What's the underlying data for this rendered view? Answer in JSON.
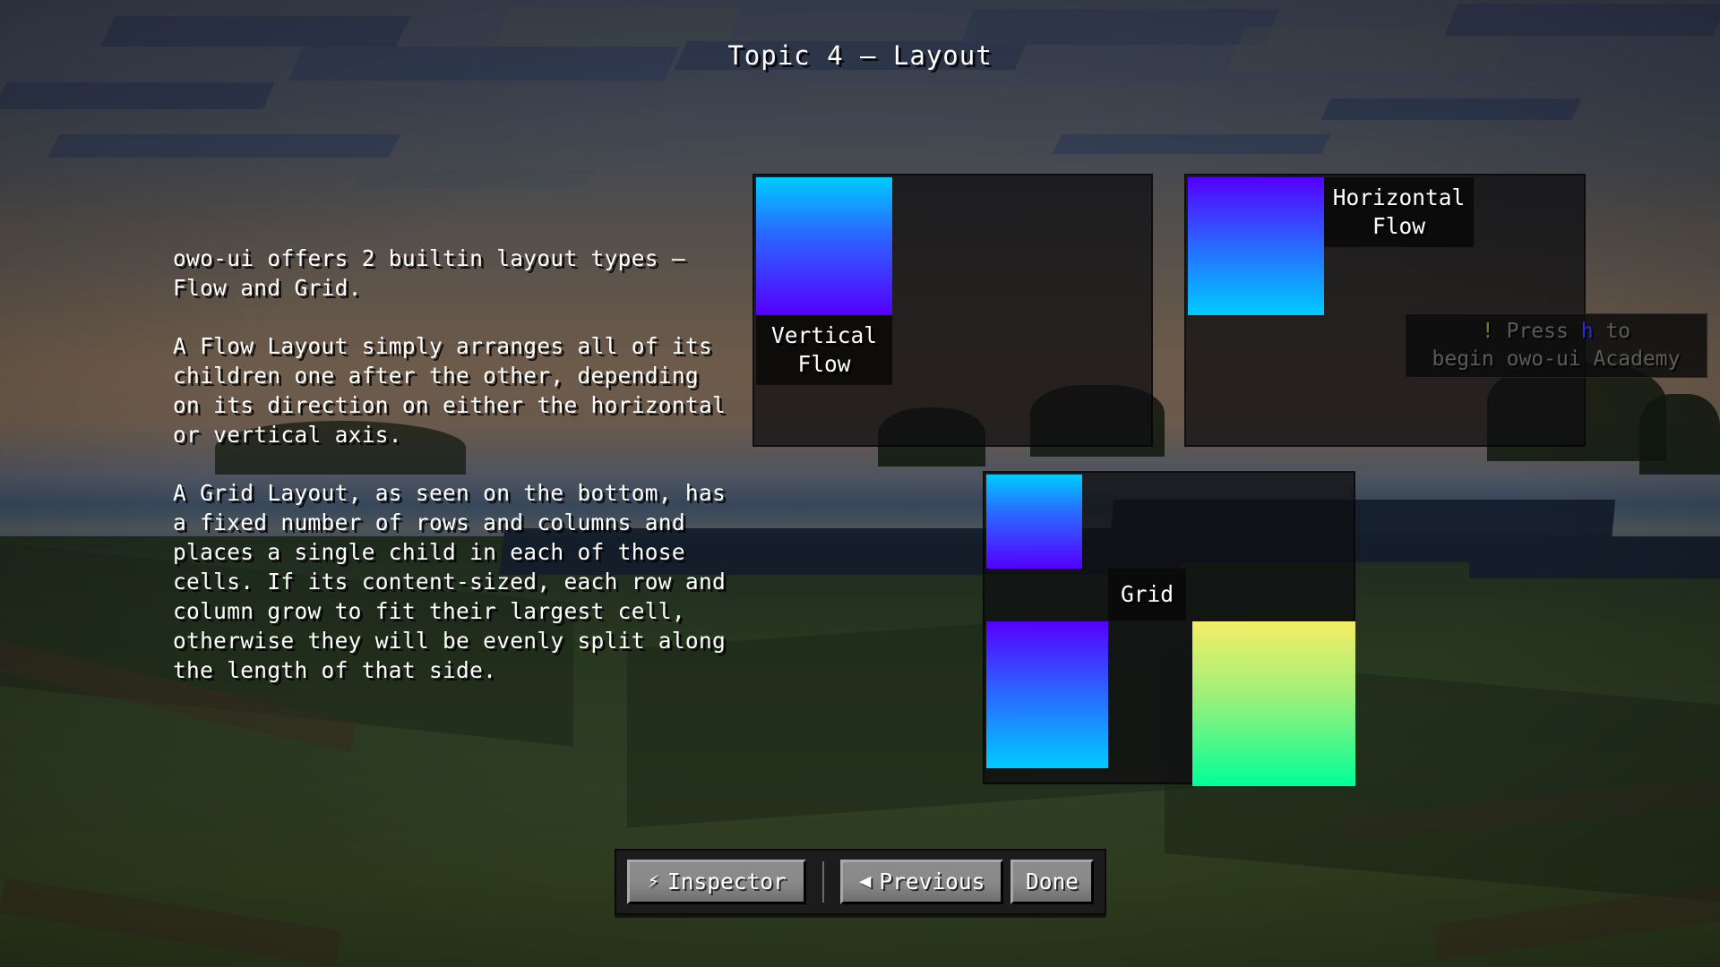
{
  "header": {
    "title": "Topic 4 – Layout"
  },
  "description": {
    "paragraphs": [
      "owo-ui offers 2 builtin layout types – Flow and Grid.",
      "A Flow Layout simply arranges all of its children one after the other, depending on its direction on either the horizontal or vertical axis.",
      "A Grid Layout, as seen on the bottom, has a fixed number of rows and columns and places a single child in each of those cells. If its content-sized, each row and column grow to fit their largest cell, otherwise they will be evenly split along the length of that side."
    ]
  },
  "demos": {
    "vertical_flow": {
      "label": "Vertical Flow",
      "swatch_gradient_from": "#00CCFF",
      "swatch_gradient_to": "#5500FF"
    },
    "horizontal_flow": {
      "label": "Horizontal Flow",
      "swatch_gradient_from": "#5500FF",
      "swatch_gradient_to": "#00CCFF"
    },
    "grid": {
      "label": "Grid",
      "cells": [
        {
          "position": "top-left",
          "gradient_from": "#00CCFF",
          "gradient_to": "#5500FF"
        },
        {
          "position": "bottom-left",
          "gradient_from": "#5500FF",
          "gradient_to": "#00CCFF"
        },
        {
          "position": "bottom-right",
          "gradient_from": "#F5EE66",
          "gradient_to": "#00FF99"
        }
      ]
    }
  },
  "toast": {
    "bang": "!",
    "before_key": "Press",
    "key": "h",
    "after_key": "to",
    "line2": "begin owo-ui Academy",
    "bang_color": "#7D7A1F",
    "key_color": "#2B2BD8"
  },
  "buttons": {
    "inspector": {
      "label": "Inspector",
      "icon": "lightning-bolt"
    },
    "previous": {
      "label": "Previous",
      "icon": "triangle-left"
    },
    "done": {
      "label": "Done"
    }
  }
}
